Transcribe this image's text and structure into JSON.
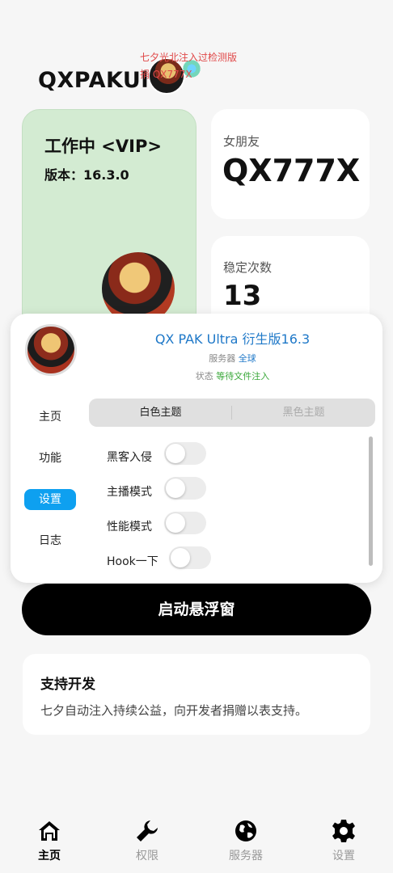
{
  "header": {
    "title": "QXPAKUlt",
    "watermark_line1": "七夕光北注入过检测版",
    "watermark_line2": "捐 QX777X"
  },
  "status_card": {
    "title": "工作中 <VIP>",
    "version": "版本：16.3.0"
  },
  "girlfriend_card": {
    "label": "女朋友",
    "value": "QX777X"
  },
  "stable_card": {
    "label": "稳定次数",
    "value": "13"
  },
  "float_window": {
    "title": "QX PAK Ultra 衍生版16.3",
    "server_label": "服务器",
    "server_value": "全球",
    "status_label": "状态",
    "status_value": "等待文件注入",
    "theme_tabs": [
      "白色主题",
      "黑色主题"
    ],
    "side_menu": [
      "主页",
      "功能",
      "设置",
      "日志"
    ],
    "active_side": "设置",
    "options": [
      {
        "label": "黑客入侵",
        "on": false
      },
      {
        "label": "主播模式",
        "on": false
      },
      {
        "label": "性能模式",
        "on": false
      },
      {
        "label": "Hook一下",
        "on": false
      }
    ]
  },
  "launch_button": {
    "label": "启动悬浮窗"
  },
  "support": {
    "title": "支持开发",
    "text": "七夕自动注入持续公益，向开发者捐赠以表支持。"
  },
  "bottom_nav": [
    {
      "label": "主页",
      "icon": "home-icon",
      "active": true
    },
    {
      "label": "权限",
      "icon": "wrench-icon",
      "active": false
    },
    {
      "label": "服务器",
      "icon": "globe-icon",
      "active": false
    },
    {
      "label": "设置",
      "icon": "gear-icon",
      "active": false
    }
  ],
  "colors": {
    "accent_blue": "#1e78c8",
    "active_tab": "#0ea0f0",
    "status_green": "#3aa83a",
    "card_green": "#d3ebd2",
    "watermark_red": "#e04848"
  }
}
